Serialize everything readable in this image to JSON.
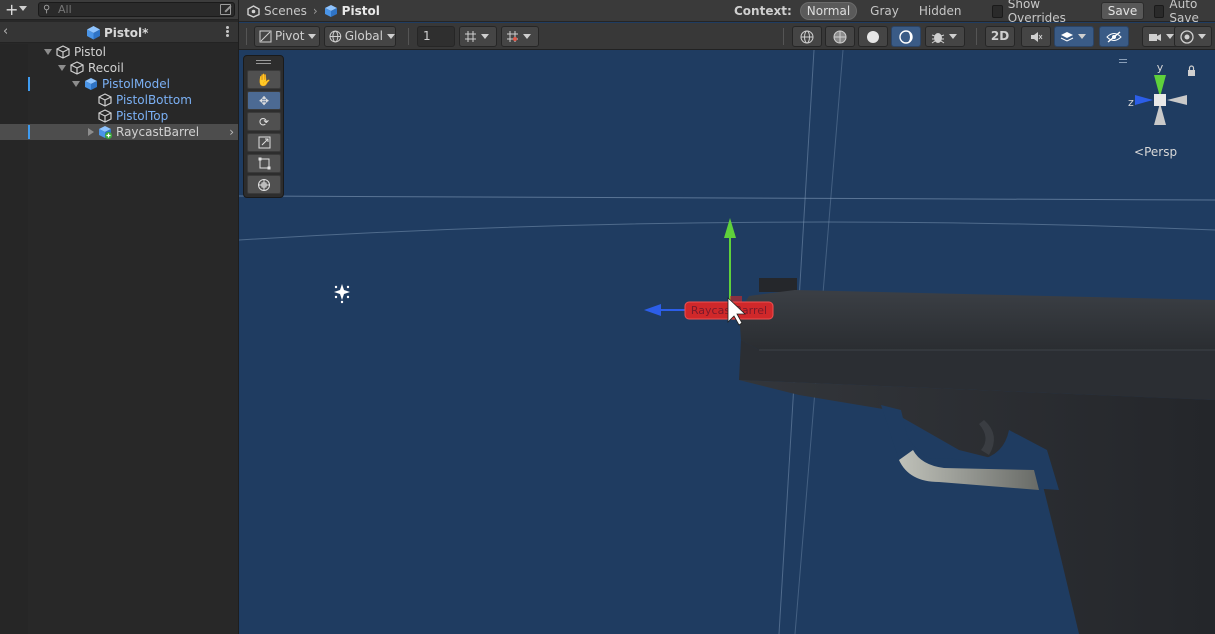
{
  "hierarchy": {
    "search_placeholder": "All",
    "scene_title": "Pistol*",
    "items": [
      {
        "label": "Pistol",
        "kind": "plain",
        "depth": 0,
        "expanded": true
      },
      {
        "label": "Recoil",
        "kind": "plain",
        "depth": 1,
        "expanded": true
      },
      {
        "label": "PistolModel",
        "kind": "prefab",
        "depth": 2,
        "expanded": true
      },
      {
        "label": "PistolBottom",
        "kind": "prefab",
        "depth": 3
      },
      {
        "label": "PistolTop",
        "kind": "prefab",
        "depth": 3
      },
      {
        "label": "RaycastBarrel",
        "kind": "plain-added",
        "depth": 3,
        "expanded": false,
        "selected": true
      }
    ]
  },
  "scene": {
    "breadcrumb": {
      "root": "Scenes",
      "current": "Pistol"
    },
    "context": {
      "label": "Context:",
      "options": [
        "Normal",
        "Gray",
        "Hidden"
      ],
      "active": "Normal"
    },
    "show_overrides_label": "Show Overrides",
    "save_label": "Save",
    "auto_save_label": "Auto Save",
    "toolbar": {
      "pivot_label": "Pivot",
      "global_label": "Global",
      "grid_snap_value": "1",
      "mode_2d_label": "2D"
    },
    "gizmo": {
      "y_label": "y",
      "z_label": "z",
      "projection_label": "Persp"
    },
    "selected_object_label": "RaycastBarrel"
  },
  "colors": {
    "viewport_bg": "#1f3c61",
    "prefab_text": "#7bb0f4",
    "selection_label_bg": "#d0282a",
    "axis_x": "#e2322c",
    "axis_y": "#5fd13b",
    "axis_z": "#2c5ee8"
  }
}
